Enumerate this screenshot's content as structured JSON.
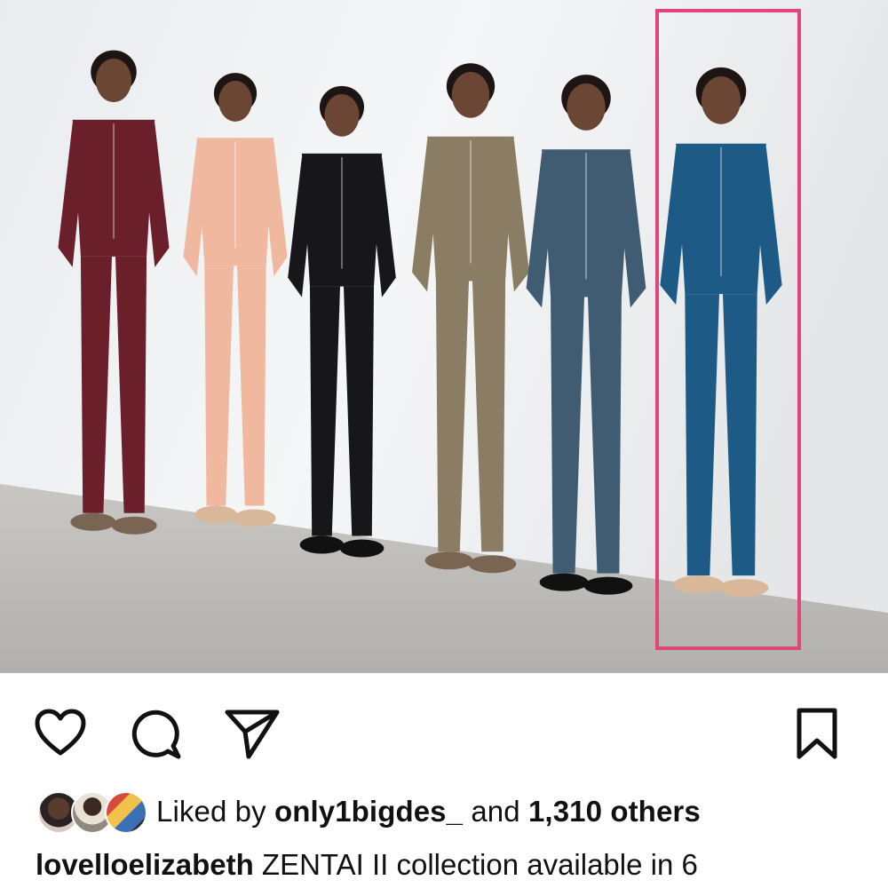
{
  "post": {
    "image_alt": "Six models in zip-front jumpsuits lined up against a white wall",
    "highlight_color": "#e0457b",
    "jumpsuit_colors": [
      "#6b1f2a",
      "#f1b8a0",
      "#17171a",
      "#8b7d63",
      "#3f5c73",
      "#1e5a86"
    ]
  },
  "actions": {
    "like_icon": "heart-icon",
    "comment_icon": "comment-icon",
    "share_icon": "paper-plane-icon",
    "save_icon": "bookmark-icon"
  },
  "likes": {
    "prefix": "Liked by ",
    "user": "only1bigdes_",
    "middle": " and ",
    "count": "1,310 others"
  },
  "caption": {
    "username": "lovelloelizabeth",
    "text": "ZENTAI II collection available in 6"
  }
}
